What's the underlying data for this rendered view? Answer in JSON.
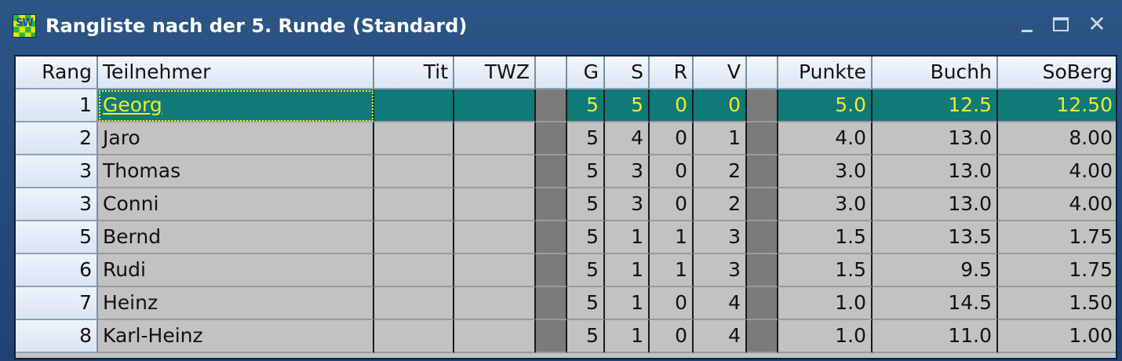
{
  "window": {
    "title": "Rangliste nach der 5. Runde (Standard)",
    "app_icon_label": "SW",
    "controls": [
      "minimize",
      "maximize",
      "close"
    ]
  },
  "table": {
    "headers": {
      "rang": "Rang",
      "teilnehmer": "Teilnehmer",
      "tit": "Tit",
      "twz": "TWZ",
      "blank1": "",
      "g": "G",
      "s": "S",
      "r": "R",
      "v": "V",
      "blank2": "",
      "punkte": "Punkte",
      "buchh": "Buchh",
      "soberg": "SoBerg"
    },
    "rows": [
      {
        "rang": "1",
        "name": "Georg",
        "tit": "",
        "twz": "",
        "g": "5",
        "s": "5",
        "r": "0",
        "v": "0",
        "punkte": "5.0",
        "buchh": "12.5",
        "soberg": "12.50",
        "selected": true
      },
      {
        "rang": "2",
        "name": "Jaro",
        "tit": "",
        "twz": "",
        "g": "5",
        "s": "4",
        "r": "0",
        "v": "1",
        "punkte": "4.0",
        "buchh": "13.0",
        "soberg": "8.00"
      },
      {
        "rang": "3",
        "name": "Thomas",
        "tit": "",
        "twz": "",
        "g": "5",
        "s": "3",
        "r": "0",
        "v": "2",
        "punkte": "3.0",
        "buchh": "13.0",
        "soberg": "4.00"
      },
      {
        "rang": "3",
        "name": "Conni",
        "tit": "",
        "twz": "",
        "g": "5",
        "s": "3",
        "r": "0",
        "v": "2",
        "punkte": "3.0",
        "buchh": "13.0",
        "soberg": "4.00"
      },
      {
        "rang": "5",
        "name": "Bernd",
        "tit": "",
        "twz": "",
        "g": "5",
        "s": "1",
        "r": "1",
        "v": "3",
        "punkte": "1.5",
        "buchh": "13.5",
        "soberg": "1.75"
      },
      {
        "rang": "6",
        "name": "Rudi",
        "tit": "",
        "twz": "",
        "g": "5",
        "s": "1",
        "r": "1",
        "v": "3",
        "punkte": "1.5",
        "buchh": "9.5",
        "soberg": "1.75"
      },
      {
        "rang": "7",
        "name": "Heinz",
        "tit": "",
        "twz": "",
        "g": "5",
        "s": "1",
        "r": "0",
        "v": "4",
        "punkte": "1.0",
        "buchh": "14.5",
        "soberg": "1.50"
      },
      {
        "rang": "8",
        "name": "Karl-Heinz",
        "tit": "",
        "twz": "",
        "g": "5",
        "s": "1",
        "r": "0",
        "v": "4",
        "punkte": "1.0",
        "buchh": "11.0",
        "soberg": "1.00"
      }
    ]
  },
  "colors": {
    "titlebar": "#2c5586",
    "grid_bg": "#c2c2c2",
    "selection_bg": "#0f7a78",
    "selection_text": "#f3ea2e",
    "separator": "#7b7b7b"
  }
}
